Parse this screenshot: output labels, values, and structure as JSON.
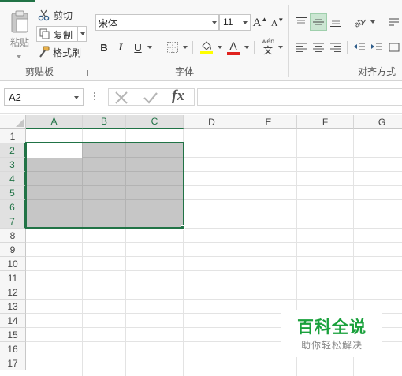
{
  "colors": {
    "excel_green": "#217346",
    "selection_fill": "#c6c6c6",
    "watermark_green": "#1aa13c"
  },
  "ribbon": {
    "clipboard": {
      "label": "剪贴板",
      "paste_label": "粘贴",
      "cut_label": "剪切",
      "copy_label": "复制",
      "format_painter_label": "格式刷"
    },
    "font": {
      "label": "字体",
      "font_name": "宋体",
      "font_size": "11",
      "bold": "B",
      "italic": "I",
      "underline": "U",
      "phonetic": "wén",
      "phonetic_char": "文",
      "font_color_letter": "A"
    },
    "alignment": {
      "label": "对齐方式"
    }
  },
  "formula_bar": {
    "name_box": "A2",
    "fx": "fx",
    "formula": ""
  },
  "sheet": {
    "columns": [
      "A",
      "B",
      "C",
      "D",
      "E",
      "F",
      "G"
    ],
    "rows": [
      "1",
      "2",
      "3",
      "4",
      "5",
      "6",
      "7",
      "8",
      "9",
      "10",
      "11",
      "12",
      "13",
      "14",
      "15",
      "16",
      "17"
    ],
    "selected_range": "A2:C7",
    "active_cell": "A2"
  },
  "watermark": {
    "title": "百科全说",
    "subtitle": "助你轻松解决"
  }
}
